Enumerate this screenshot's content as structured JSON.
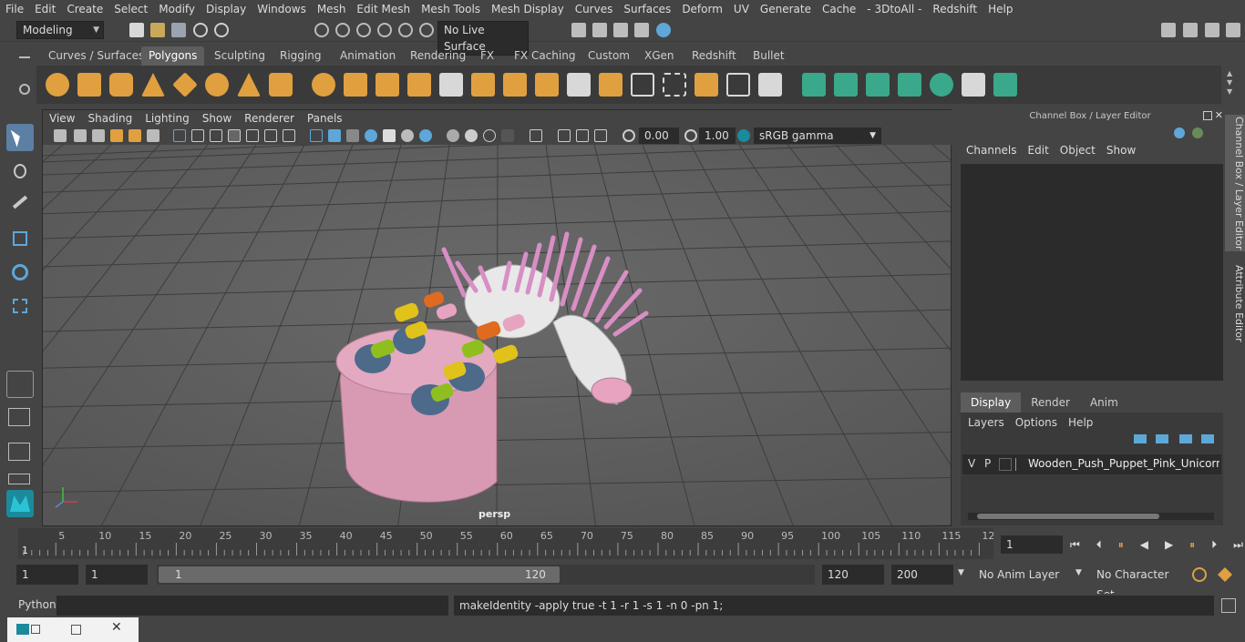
{
  "menubar": [
    "File",
    "Edit",
    "Create",
    "Select",
    "Modify",
    "Display",
    "Windows",
    "Mesh",
    "Edit Mesh",
    "Mesh Tools",
    "Mesh Display",
    "Curves",
    "Surfaces",
    "Deform",
    "UV",
    "Generate",
    "Cache",
    "- 3DtoAll -",
    "Redshift",
    "Help"
  ],
  "statusline": {
    "mode": "Modeling",
    "live_surface": "No Live Surface"
  },
  "shelf_tabs": [
    "Curves / Surfaces",
    "Polygons",
    "Sculpting",
    "Rigging",
    "Animation",
    "Rendering",
    "FX",
    "FX Caching",
    "Custom",
    "XGen",
    "Redshift",
    "Bullet"
  ],
  "shelf_active": "Polygons",
  "viewport": {
    "menu": [
      "View",
      "Shading",
      "Lighting",
      "Show",
      "Renderer",
      "Panels"
    ],
    "exposure": "0.00",
    "gamma": "1.00",
    "colorspace": "sRGB gamma",
    "camera_label": "persp"
  },
  "channelbox": {
    "title": "Channel Box / Layer Editor",
    "menu": [
      "Channels",
      "Edit",
      "Object",
      "Show"
    ],
    "display_tabs": [
      "Display",
      "Render",
      "Anim"
    ],
    "layer_menu": [
      "Layers",
      "Options",
      "Help"
    ],
    "layer_v": "V",
    "layer_p": "P",
    "layer_name": "Wooden_Push_Puppet_Pink_Unicorn_Lyi"
  },
  "sidetabs": [
    "Channel Box / Layer Editor",
    "Attribute Editor"
  ],
  "timeline": {
    "ticks": [
      "5",
      "10",
      "15",
      "20",
      "25",
      "30",
      "35",
      "40",
      "45",
      "50",
      "55",
      "60",
      "65",
      "70",
      "75",
      "80",
      "85",
      "90",
      "95",
      "100",
      "105",
      "110",
      "115",
      "12"
    ],
    "start_mark": "1",
    "current_frame": "1"
  },
  "range": {
    "start": "1",
    "playback_start": "1",
    "slider_start": "1",
    "slider_end": "120",
    "playback_end": "120",
    "end": "200",
    "anim_layer": "No Anim Layer",
    "char_set": "No Character Set"
  },
  "cmdline": {
    "lang": "Python",
    "result": "makeIdentity -apply true -t 1 -r 1 -s 1 -n 0 -pn 1;"
  },
  "colors": {
    "accent_blue": "#5ea7d8",
    "active_tab": "#5d5d5d",
    "shelf_teal": "#3aa88a"
  }
}
